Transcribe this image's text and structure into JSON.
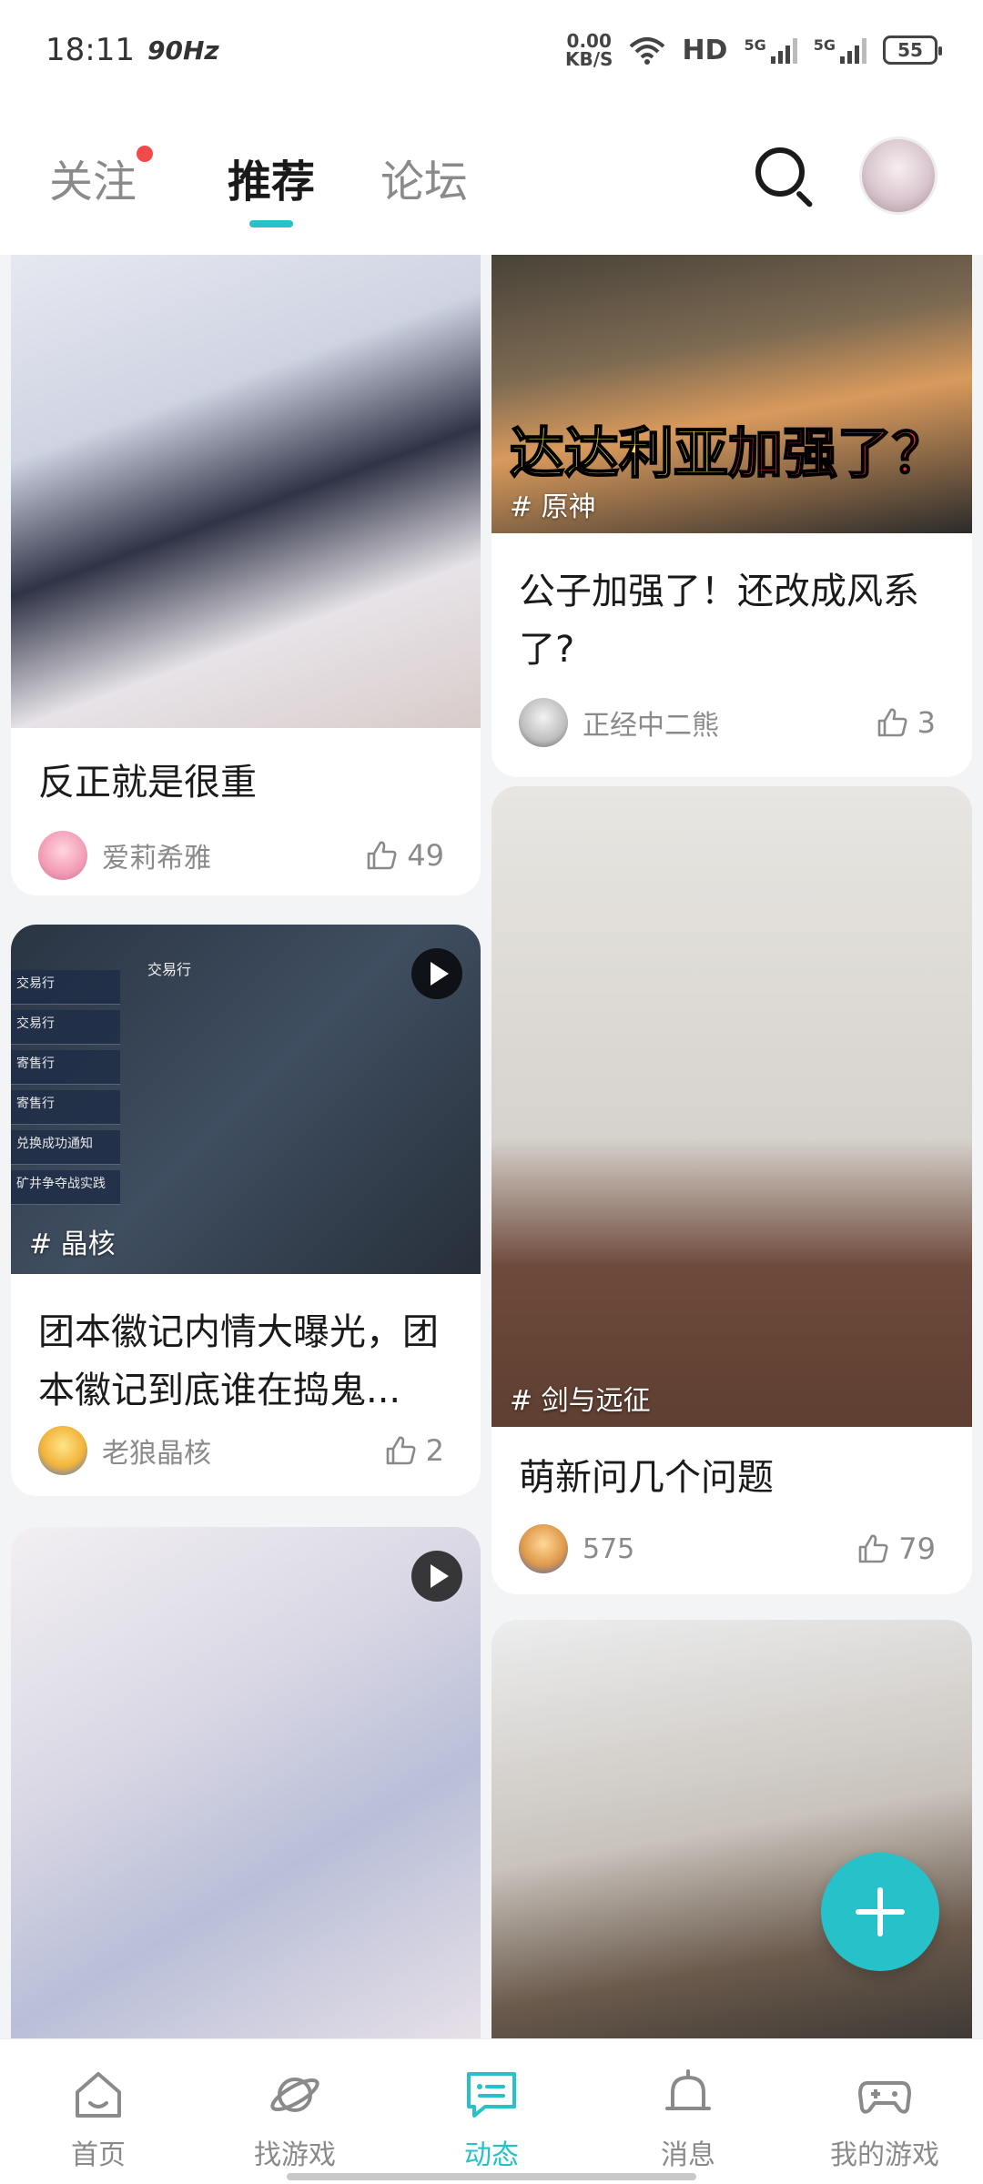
{
  "status_bar": {
    "time": "18:11",
    "refresh": "90Hz",
    "net_speed_value": "0.00",
    "net_speed_unit": "KB/S",
    "hd": "HD",
    "signal1": "5G",
    "signal2": "5G",
    "battery": "55"
  },
  "top_tabs": [
    {
      "label": "关注",
      "badge": true
    },
    {
      "label": "推荐",
      "active": true
    },
    {
      "label": "论坛"
    }
  ],
  "posts": [
    {
      "topic": "",
      "title": "反正就是很重",
      "user": "爱莉希雅",
      "likes": "49",
      "video": false
    },
    {
      "topic": "# 原神",
      "title": "公子加强了！还改成风系了?",
      "user": "正经中二熊",
      "likes": "3",
      "video": false,
      "caption_yellow": "达达利亚",
      "caption_red": "加强了？"
    },
    {
      "topic": "# 晶核",
      "title": "团本徽记内情大曝光，团本徽记到底谁在捣鬼...",
      "user": "老狼晶核",
      "likes": "2",
      "video": true,
      "game_panel_title": "交易行",
      "game_menu": [
        "交易行",
        "交易行",
        "寄售行",
        "寄售行",
        "兑换成功通知",
        "矿井争夺战实践"
      ]
    },
    {
      "topic": "# 剑与远征",
      "title": "萌新问几个问题",
      "user": "575",
      "likes": "79",
      "video": false
    },
    {
      "topic": "",
      "title": "",
      "user": "",
      "likes": "",
      "video": true
    },
    {
      "topic": "",
      "title": "",
      "user": "",
      "likes": "",
      "video": false
    }
  ],
  "bottom_nav": [
    {
      "label": "首页",
      "icon": "home-icon"
    },
    {
      "label": "找游戏",
      "icon": "planet-icon"
    },
    {
      "label": "动态",
      "icon": "chat-icon",
      "active": true
    },
    {
      "label": "消息",
      "icon": "bell-icon"
    },
    {
      "label": "我的游戏",
      "icon": "gamepad-icon"
    }
  ],
  "colors": {
    "accent": "#26c1c9",
    "badge": "#f04a4a"
  }
}
